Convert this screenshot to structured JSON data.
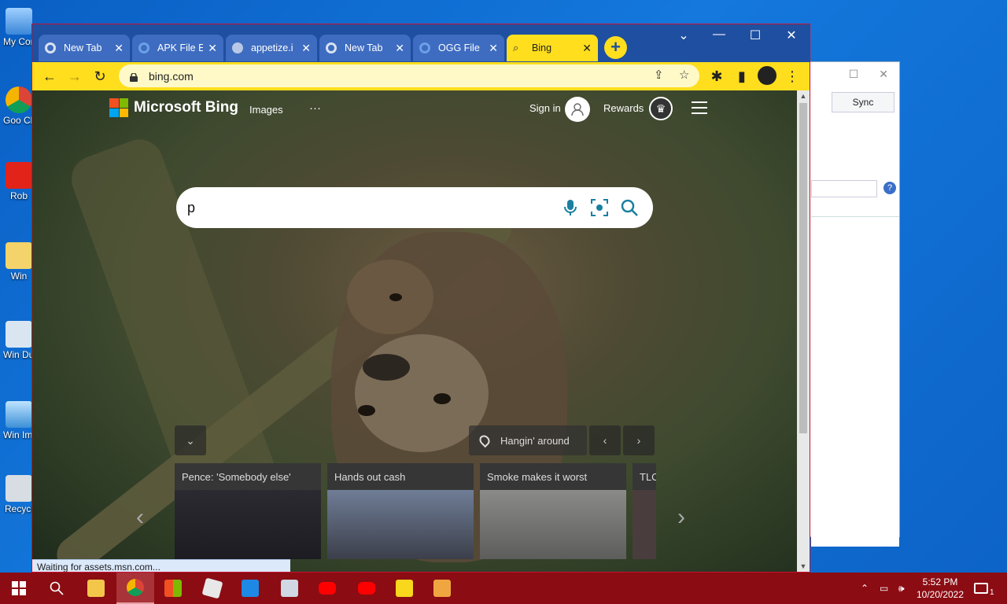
{
  "desktop": {
    "icons": [
      {
        "label": "My Comp"
      },
      {
        "label": "Goo Chro"
      },
      {
        "label": "Rob"
      },
      {
        "label": "Win"
      },
      {
        "label": "Win Duplica"
      },
      {
        "label": "Win Imag"
      },
      {
        "label": "Recycl"
      }
    ]
  },
  "bg_window": {
    "sync_label": "Sync",
    "help_label": "?"
  },
  "browser": {
    "tabs": [
      {
        "title": "New Tab"
      },
      {
        "title": "APK File E"
      },
      {
        "title": "appetize.i"
      },
      {
        "title": "New Tab"
      },
      {
        "title": "OGG File"
      },
      {
        "title": "Bing"
      }
    ],
    "new_tab_label": "+",
    "url": "bing.com",
    "status_text": "Waiting for assets.msn.com..."
  },
  "bing": {
    "logo_text": "Microsoft Bing",
    "nav_images": "Images",
    "nav_more": "···",
    "sign_in": "Sign in",
    "rewards": "Rewards",
    "search_value": "p",
    "location_label": "Hangin' around",
    "news": [
      {
        "title": "Pence: 'Somebody else'"
      },
      {
        "title": "Hands out cash"
      },
      {
        "title": "Smoke makes it worst"
      },
      {
        "title": "TLC"
      }
    ]
  },
  "taskbar": {
    "time": "5:52 PM",
    "date": "10/20/2022",
    "notification_count": "1"
  },
  "colors": {
    "tab_active": "#ffde1e",
    "tabstrip": "#1f4fa0",
    "taskbar": "#8b0c13",
    "search_icon": "#1a7fa0"
  }
}
